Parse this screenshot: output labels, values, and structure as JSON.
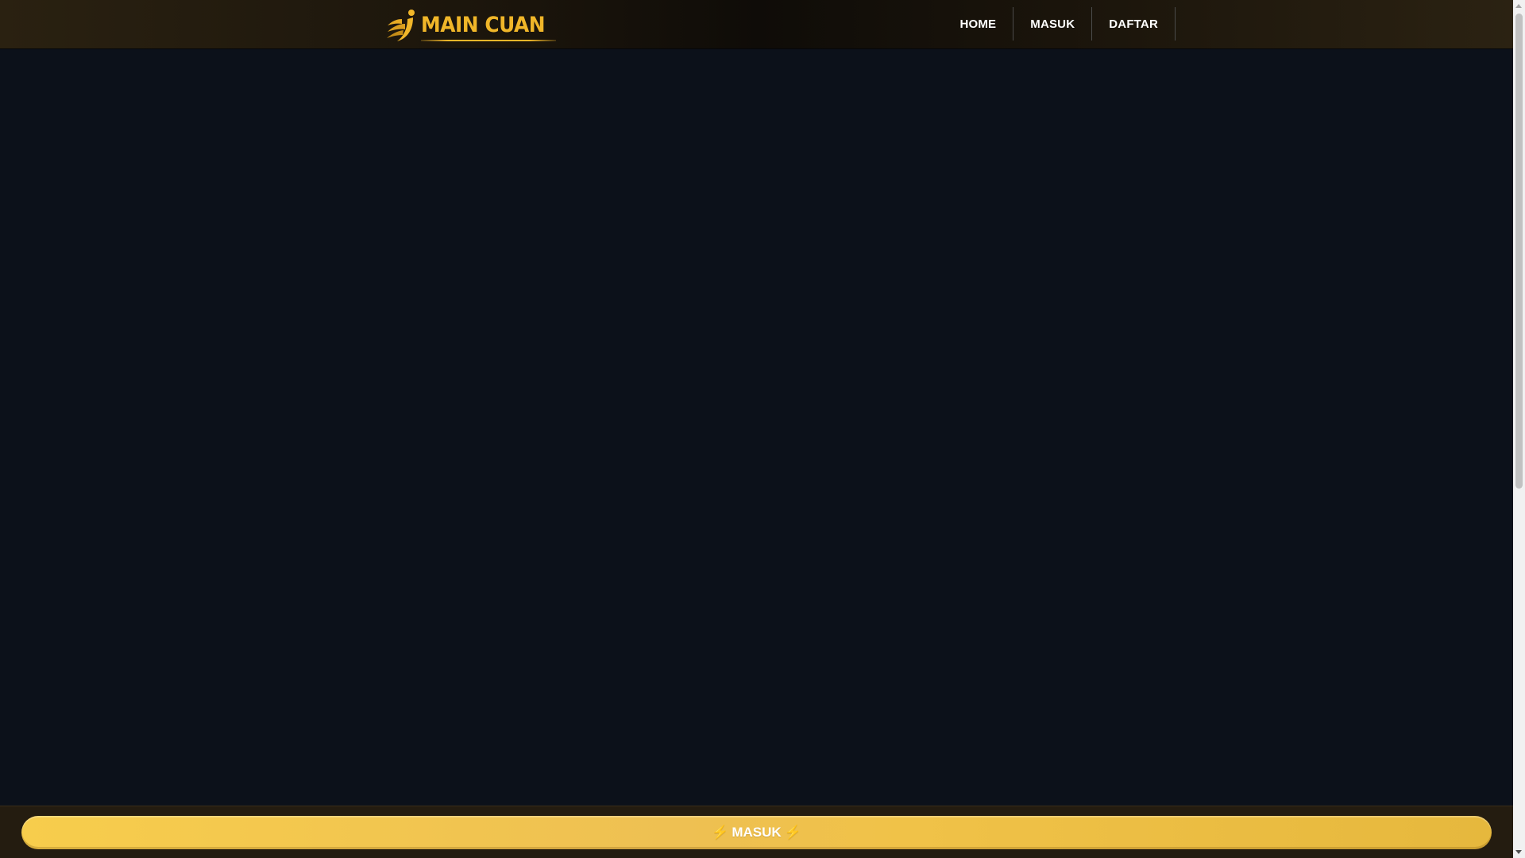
{
  "header": {
    "logo_text": "MAIN CUAN",
    "logo_icon": "gold-figure-icon",
    "nav": [
      {
        "label": "HOME"
      },
      {
        "label": "MASUK"
      },
      {
        "label": "DAFTAR"
      }
    ]
  },
  "bottom_bar": {
    "cta_label": "MASUK",
    "cta_icon": "lightning-bolt-icon"
  },
  "colors": {
    "brand_gold": "#f0b629",
    "page_background": "#0c111a",
    "header_background": "#1a140b",
    "cta_gold": "#f0c248",
    "nav_text": "#ffffff"
  }
}
